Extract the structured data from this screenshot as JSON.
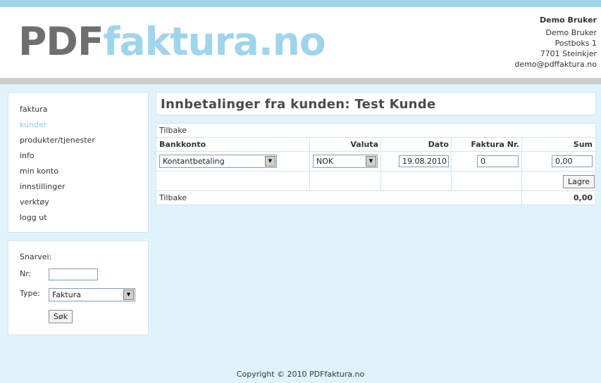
{
  "logo": {
    "part1": "PDF",
    "part2": "faktura.no"
  },
  "user": {
    "name": "Demo Bruker",
    "lines": [
      "Demo Bruker",
      "Postboks 1",
      "7701 Steinkjer",
      "demo@pdffaktura.no"
    ]
  },
  "nav": {
    "items": [
      {
        "label": "faktura",
        "active": false
      },
      {
        "label": "kunder",
        "active": true
      },
      {
        "label": "produkter/tjenester",
        "active": false
      },
      {
        "label": "info",
        "active": false
      },
      {
        "label": "min konto",
        "active": false
      },
      {
        "label": "innstillinger",
        "active": false
      },
      {
        "label": "verktøy",
        "active": false
      },
      {
        "label": "logg ut",
        "active": false
      }
    ]
  },
  "shortcut": {
    "title": "Snarvei:",
    "nr_label": "Nr:",
    "nr_value": "",
    "type_label": "Type:",
    "type_value": "Faktura",
    "search_label": "Søk"
  },
  "page": {
    "title": "Innbetalinger fra kunden: Test Kunde"
  },
  "table": {
    "back_top": "Tilbake",
    "headers": {
      "bankkonto": "Bankkonto",
      "valuta": "Valuta",
      "dato": "Dato",
      "faktura_nr": "Faktura Nr.",
      "sum": "Sum"
    },
    "row": {
      "bankkonto": "Kontantbetaling",
      "valuta": "NOK",
      "dato": "19.08.2010",
      "faktura_nr": "0",
      "sum": "0,00"
    },
    "save_label": "Lagre",
    "back_bottom": "Tilbake",
    "total": "0,00"
  },
  "footer": {
    "copyright": "Copyright © 2010 PDFfaktura.no"
  },
  "colors": {
    "accent": "#9fd5ec",
    "background": "#e0f3fb",
    "logo_gray": "#6e6e6e"
  }
}
